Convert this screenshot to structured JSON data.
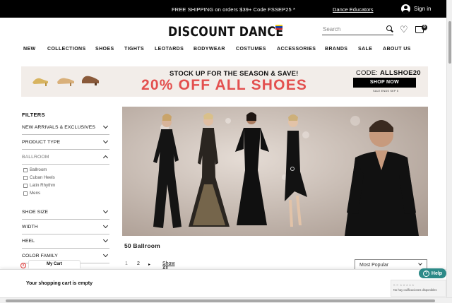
{
  "topbar": {
    "promo": "FREE SHIPPING on orders $39+ Code FSSEP25 *",
    "educators": "Dance Educators",
    "signin": "Sign in"
  },
  "header": {
    "logo": "DISCOUNT DANCE",
    "search_placeholder": "Search",
    "cart_count": "0",
    "icons": [
      "venezuela-flag-icon",
      "search-icon",
      "heart-icon",
      "cart-icon",
      "user-icon"
    ]
  },
  "nav": [
    "NEW",
    "COLLECTIONS",
    "SHOES",
    "TIGHTS",
    "LEOTARDS",
    "BODYWEAR",
    "COSTUMES",
    "ACCESSORIES",
    "BRANDS",
    "SALE",
    "ABOUT US"
  ],
  "banner": {
    "headline": "STOCK UP FOR THE SEASON & SAVE!",
    "offer": "20% OFF ALL SHOES",
    "code_label": "CODE: ",
    "code": "ALLSHOE20",
    "cta": "SHOP NOW",
    "ends": "SALE ENDS SEP 5",
    "colors": {
      "offer": "#e3504f",
      "background": "#f2ede9"
    }
  },
  "filters": {
    "title": "FILTERS",
    "groups": [
      "NEW ARRIVALS & EXCLUSIVES",
      "PRODUCT TYPE",
      "BALLROOM",
      "SHOE SIZE",
      "WIDTH",
      "HEEL",
      "COLOR FAMILY"
    ],
    "ballroom_options": [
      "Ballroom",
      "Cuban Heels",
      "Latin Rhythm",
      "Mens"
    ]
  },
  "results": {
    "title": "50 Ballroom",
    "pages": [
      "1",
      "2"
    ],
    "next": "▸",
    "show_all": "Show All",
    "sort": "Most Popular"
  },
  "cart": {
    "tab": "My Cart",
    "close": "x",
    "empty": "Your shopping cart is empty"
  },
  "help": {
    "label": "Help",
    "color": "#2d8a88"
  },
  "reviews": {
    "score": "0.0 ★★★★★",
    "text": "No hay calificaciones disponibles"
  }
}
